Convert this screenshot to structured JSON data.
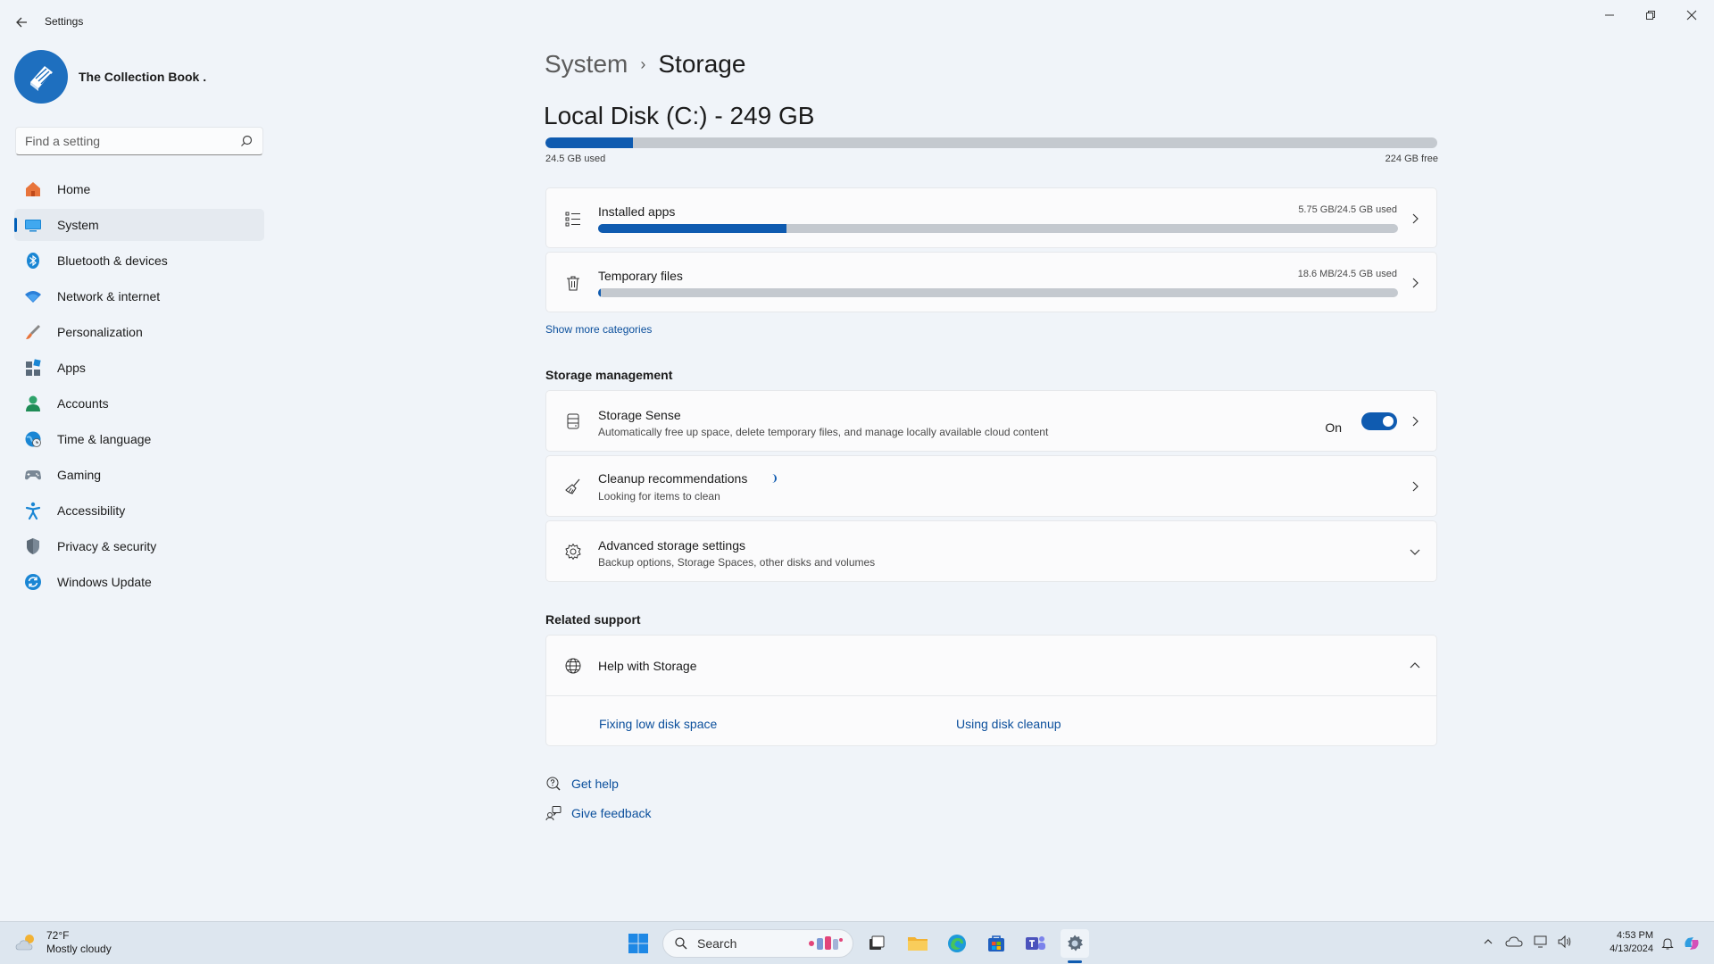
{
  "window": {
    "app_title": "Settings",
    "controls": [
      "minimize",
      "restore",
      "close"
    ]
  },
  "profile": {
    "name": "The Collection Book ."
  },
  "search": {
    "placeholder": "Find a setting"
  },
  "sidebar": {
    "items": [
      {
        "label": "Home",
        "icon": "home-icon",
        "selected": false
      },
      {
        "label": "System",
        "icon": "system-icon",
        "selected": true
      },
      {
        "label": "Bluetooth & devices",
        "icon": "bluetooth-icon",
        "selected": false
      },
      {
        "label": "Network & internet",
        "icon": "wifi-icon",
        "selected": false
      },
      {
        "label": "Personalization",
        "icon": "brush-icon",
        "selected": false
      },
      {
        "label": "Apps",
        "icon": "apps-icon",
        "selected": false
      },
      {
        "label": "Accounts",
        "icon": "accounts-icon",
        "selected": false
      },
      {
        "label": "Time & language",
        "icon": "globe-clock-icon",
        "selected": false
      },
      {
        "label": "Gaming",
        "icon": "gamepad-icon",
        "selected": false
      },
      {
        "label": "Accessibility",
        "icon": "accessibility-icon",
        "selected": false
      },
      {
        "label": "Privacy & security",
        "icon": "shield-icon",
        "selected": false
      },
      {
        "label": "Windows Update",
        "icon": "update-icon",
        "selected": false
      }
    ]
  },
  "breadcrumb": {
    "parent": "System",
    "separator": "›",
    "current": "Storage"
  },
  "disk": {
    "title": "Local Disk (C:) - 249 GB",
    "used_label": "24.5 GB used",
    "free_label": "224 GB free",
    "used_fraction": 0.098
  },
  "categories": [
    {
      "label": "Installed apps",
      "usage": "5.75 GB/24.5 GB used",
      "fraction": 0.235,
      "icon": "list-icon"
    },
    {
      "label": "Temporary files",
      "usage": "18.6 MB/24.5 GB used",
      "fraction": 0.001,
      "icon": "trash-icon"
    }
  ],
  "show_more": "Show more categories",
  "storage_management": {
    "heading": "Storage management",
    "storage_sense": {
      "title": "Storage Sense",
      "subtitle": "Automatically free up space, delete temporary files, and manage locally available cloud content",
      "toggle_label": "On",
      "toggle_on": true
    },
    "cleanup": {
      "title": "Cleanup recommendations",
      "subtitle": "Looking for items to clean"
    },
    "advanced": {
      "title": "Advanced storage settings",
      "subtitle": "Backup options, Storage Spaces, other disks and volumes"
    }
  },
  "related_support": {
    "heading": "Related support",
    "help_title": "Help with Storage",
    "links": [
      "Fixing low disk space",
      "Using disk cleanup"
    ]
  },
  "footer_links": {
    "get_help": "Get help",
    "give_feedback": "Give feedback"
  },
  "taskbar": {
    "weather_temp": "72°F",
    "weather_desc": "Mostly cloudy",
    "search_label": "Search",
    "time": "4:53 PM",
    "date": "4/13/2024",
    "accent": "#0f5bb0"
  }
}
